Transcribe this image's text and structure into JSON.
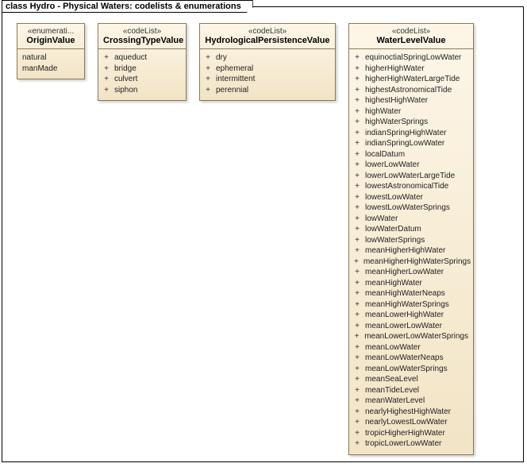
{
  "frame": {
    "title": "class Hydro - Physical Waters: codelists & enumerations"
  },
  "classes": {
    "origin": {
      "stereo": "«enumerati...",
      "name": "OriginValue",
      "attrs": [
        "natural",
        "manMade"
      ]
    },
    "crossing": {
      "stereo": "«codeList»",
      "name": "CrossingTypeValue",
      "attrs": [
        "aqueduct",
        "bridge",
        "culvert",
        "siphon"
      ]
    },
    "hydropers": {
      "stereo": "«codeList»",
      "name": "HydrologicalPersistenceValue",
      "attrs": [
        "dry",
        "ephemeral",
        "intermittent",
        "perennial"
      ]
    },
    "waterlevel": {
      "stereo": "«codeList»",
      "name": "WaterLevelValue",
      "attrs": [
        "equinoctialSpringLowWater",
        "higherHighWater",
        "higherHighWaterLargeTide",
        "highestAstronomicalTide",
        "highestHighWater",
        "highWater",
        "highWaterSprings",
        "indianSpringHighWater",
        "indianSpringLowWater",
        "localDatum",
        "lowerLowWater",
        "lowerLowWaterLargeTide",
        "lowestAstronomicalTide",
        "lowestLowWater",
        "lowestLowWaterSprings",
        "lowWater",
        "lowWaterDatum",
        "lowWaterSprings",
        "meanHigherHighWater",
        "meanHigherHighWaterSprings",
        "meanHigherLowWater",
        "meanHighWater",
        "meanHighWaterNeaps",
        "meanHighWaterSprings",
        "meanLowerHighWater",
        "meanLowerLowWater",
        "meanLowerLowWaterSprings",
        "meanLowWater",
        "meanLowWaterNeaps",
        "meanLowWaterSprings",
        "meanSeaLevel",
        "meanTideLevel",
        "meanWaterLevel",
        "nearlyHighestHighWater",
        "nearlyLowestLowWater",
        "tropicHigherHighWater",
        "tropicLowerLowWater"
      ]
    }
  },
  "vis_plus": "+"
}
